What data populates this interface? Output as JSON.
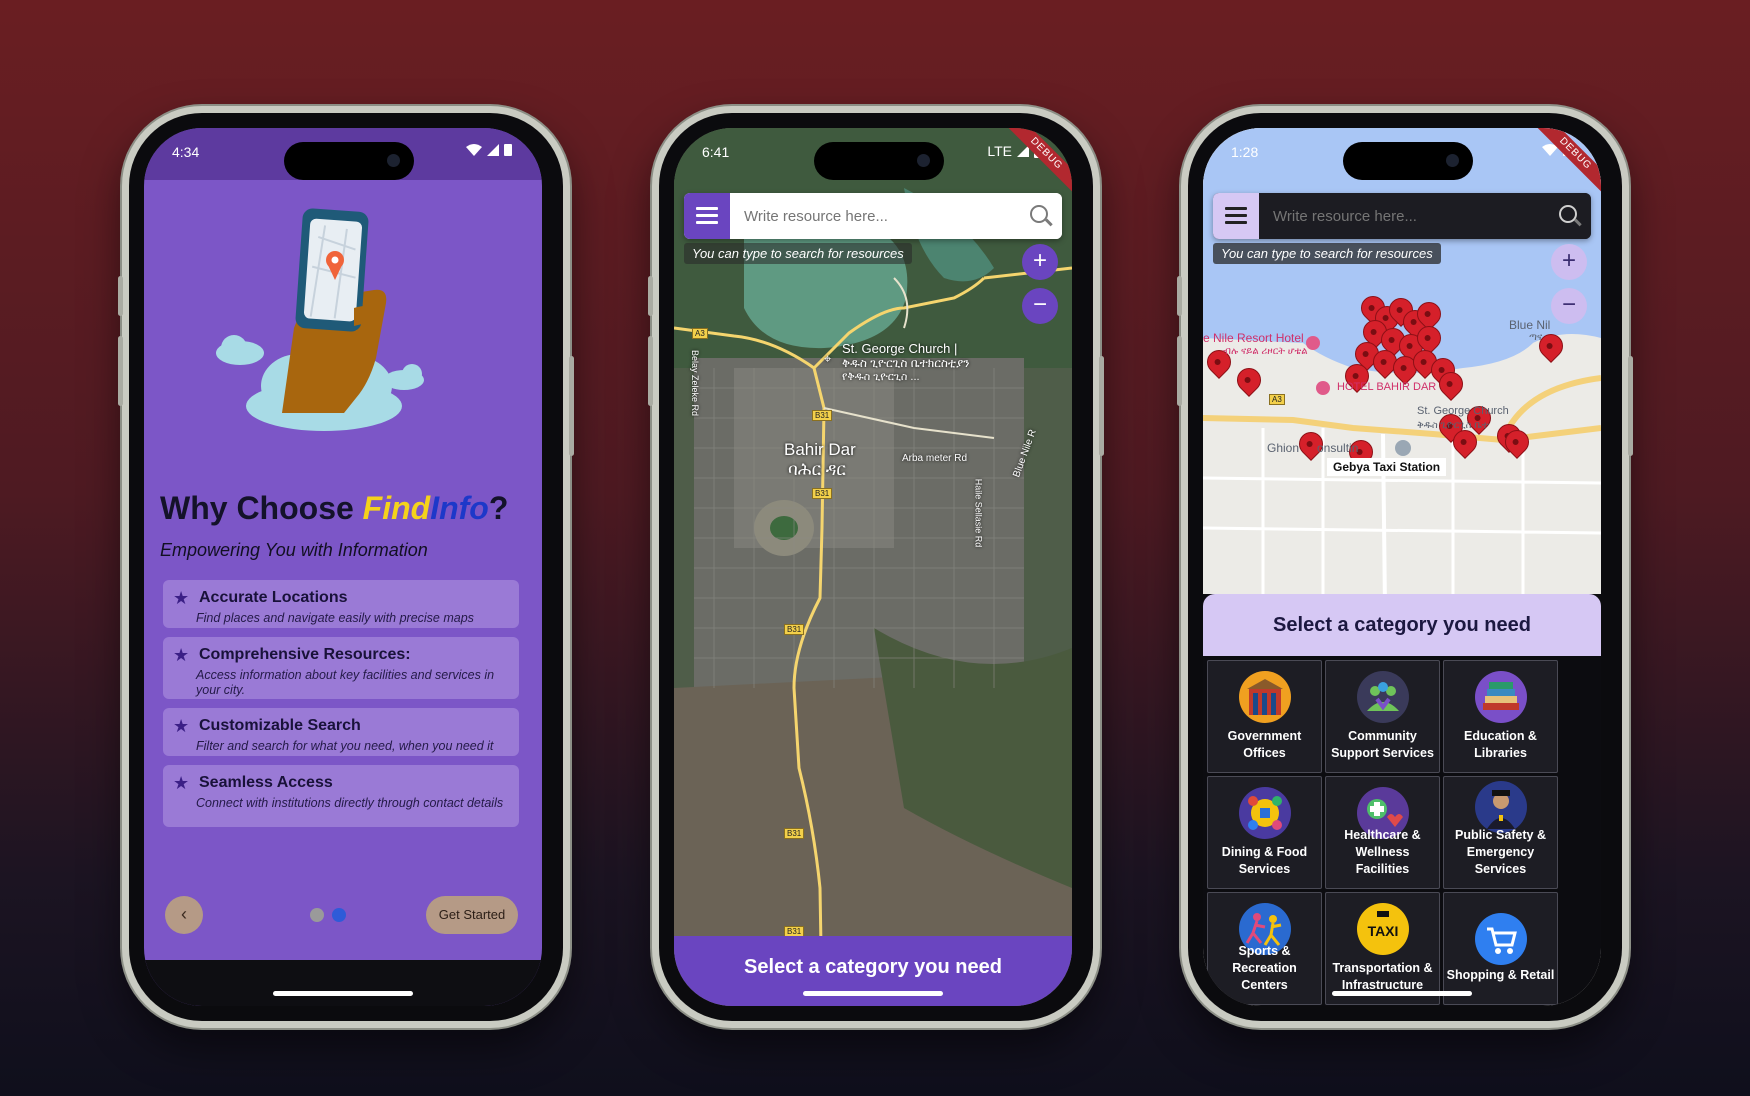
{
  "phone1": {
    "status": {
      "time": "4:34"
    },
    "title_prefix": "Why Choose ",
    "title_brand_a": "Find",
    "title_brand_b": "Info",
    "title_suffix": "?",
    "subtitle": "Empowering You with Information",
    "features": [
      {
        "title": "Accurate Locations",
        "desc": "Find places and navigate easily with precise maps"
      },
      {
        "title": "Comprehensive Resources:",
        "desc": "Access information about key facilities and services in your city."
      },
      {
        "title": "Customizable Search",
        "desc": "Filter and search for what you need, when you need it"
      },
      {
        "title": "Seamless Access",
        "desc": "Connect with institutions directly through contact details"
      }
    ],
    "back_icon": "‹",
    "get_started": "Get Started",
    "page_index": 2,
    "page_count": 2
  },
  "phone2": {
    "status": {
      "time": "6:41",
      "network": "LTE"
    },
    "debug": "DEBUG",
    "search_placeholder": "Write resource here...",
    "hint": "You can type to search for resources",
    "zoom_in": "+",
    "zoom_out": "−",
    "labels": {
      "church": "St. George Church |",
      "church_am": "ቅዱስ ጊዮርጊስ ቤተክርስቲያን",
      "church_am2": "የቅዱስ ጊዮርጊስ ...",
      "city": "Bahir Dar",
      "city_am": "ባሕር ዳር",
      "arba": "Arba meter Rd",
      "haile": "Haile Sellasie Rd",
      "blue_nile": "Blue Nile R",
      "belay": "Belay Zeleke Rd"
    },
    "roads": [
      "A3",
      "B31",
      "B31",
      "B31",
      "B31",
      "B31"
    ],
    "category_button": "Select a category you need"
  },
  "phone3": {
    "status": {
      "time": "1:28"
    },
    "debug": "DEBUG",
    "search_placeholder": "Write resource here...",
    "hint": "You can type to search for resources",
    "zoom_in": "+",
    "zoom_out": "−",
    "labels": {
      "resort": "e Nile Resort Hotel",
      "resort_am": "ብሉ ናይል ሪዞርት ሆቴል",
      "hotel": "HOTEL BAHIR DAR",
      "st_george": "St. George Church",
      "st_george_am": "ቅዱስ ጊዮርጊስ ቤተ",
      "ghion": "Ghion",
      "consulting": "onsultin",
      "blue_nile": "Blue Nil",
      "blue_nile_am": "ጣና",
      "road": "A3",
      "taxi": "Gebya Taxi Station"
    },
    "sheet_title": "Select a category you need",
    "categories": [
      {
        "label": "Government Offices",
        "icon": "government-icon",
        "color": "#f0a020"
      },
      {
        "label": "Community Support Services",
        "icon": "community-icon",
        "color": "#6fc35a"
      },
      {
        "label": "Education & Libraries",
        "icon": "books-icon",
        "color": "#7a4fc8"
      },
      {
        "label": "Dining & Food Services",
        "icon": "dining-icon",
        "color": "#2b6fd6"
      },
      {
        "label": "Healthcare & Wellness Facilities",
        "icon": "healthcare-icon",
        "color": "#4fbf6a"
      },
      {
        "label": "Public Safety & Emergency Services",
        "icon": "police-icon",
        "color": "#2a3a8a"
      },
      {
        "label": "Sports & Recreation Centers",
        "icon": "sports-icon",
        "color": "#e04a7a"
      },
      {
        "label": "Transportation & Infrastructure",
        "icon": "taxi-icon",
        "color": "#f4c20d"
      },
      {
        "label": "Shopping & Retail",
        "icon": "cart-icon",
        "color": "#2f7ff0"
      }
    ],
    "taxi_badge": "TAXI"
  },
  "colors": {
    "purple_primary": "#6a45c0",
    "purple_light": "#d6c8f4",
    "onboarding_bg": "#7c56c7",
    "pin_red": "#d5202a",
    "dot_active": "#2e5bd8",
    "dot_inactive": "#9a9a9a"
  }
}
